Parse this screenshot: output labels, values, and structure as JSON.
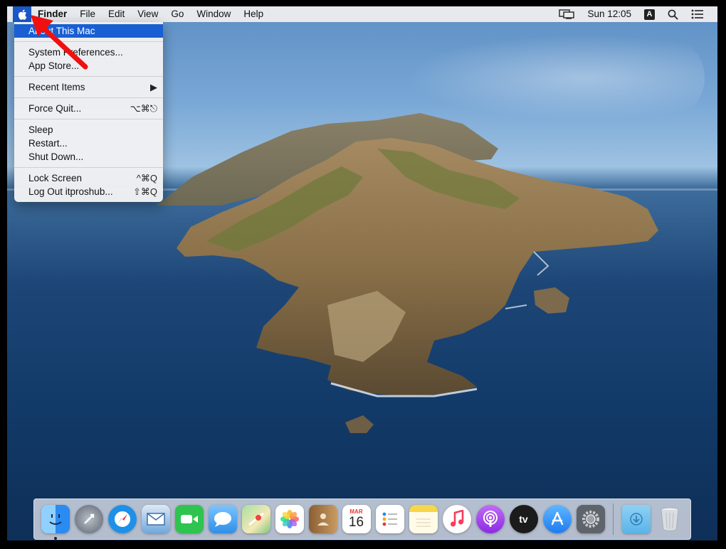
{
  "menubar": {
    "apple_icon": "apple-logo-icon",
    "app_name": "Finder",
    "items": [
      "File",
      "Edit",
      "View",
      "Go",
      "Window",
      "Help"
    ],
    "clock": "Sun 12:05",
    "input_source": "A",
    "status_icons": [
      "display-mirroring-icon",
      "search-icon",
      "notification-center-icon"
    ]
  },
  "apple_menu": {
    "about": "About This Mac",
    "system_prefs": "System Preferences...",
    "app_store": "App Store...",
    "recent_items": "Recent Items",
    "force_quit": "Force Quit...",
    "force_quit_shortcut": "⌥⌘⎋",
    "sleep": "Sleep",
    "restart": "Restart...",
    "shut_down": "Shut Down...",
    "lock_screen": "Lock Screen",
    "lock_screen_shortcut": "^⌘Q",
    "log_out": "Log Out itproshub...",
    "log_out_shortcut": "⇧⌘Q",
    "submenu_arrow": "▶"
  },
  "dock": {
    "apps": [
      {
        "name": "finder-icon",
        "color": "#2a8bf2"
      },
      {
        "name": "launchpad-icon",
        "color": "#8d96a3"
      },
      {
        "name": "safari-icon",
        "color": "#1e90e8"
      },
      {
        "name": "mail-icon",
        "color": "#6fa8dc"
      },
      {
        "name": "facetime-icon",
        "color": "#2ec44f"
      },
      {
        "name": "messages-icon",
        "color": "#3fa3f5"
      },
      {
        "name": "maps-icon",
        "color": "#7bc67b"
      },
      {
        "name": "photos-icon",
        "color": "#ffffff"
      },
      {
        "name": "contacts-icon",
        "color": "#b8874f"
      },
      {
        "name": "calendar-icon",
        "color": "#ffffff"
      },
      {
        "name": "reminders-icon",
        "color": "#ffffff"
      },
      {
        "name": "notes-icon",
        "color": "#f6d64a"
      },
      {
        "name": "music-icon",
        "color": "#fb4b6a"
      },
      {
        "name": "podcasts-icon",
        "color": "#9b43e0"
      },
      {
        "name": "tv-icon",
        "color": "#1b1b1b"
      },
      {
        "name": "app-store-icon",
        "color": "#1e8ef5"
      },
      {
        "name": "system-preferences-icon",
        "color": "#7a7f87"
      }
    ],
    "calendar_month": "MAR",
    "calendar_day": "16",
    "tv_label": "tv",
    "downloads_color": "#5ab4e8",
    "trash_color": "#d9dde2"
  }
}
